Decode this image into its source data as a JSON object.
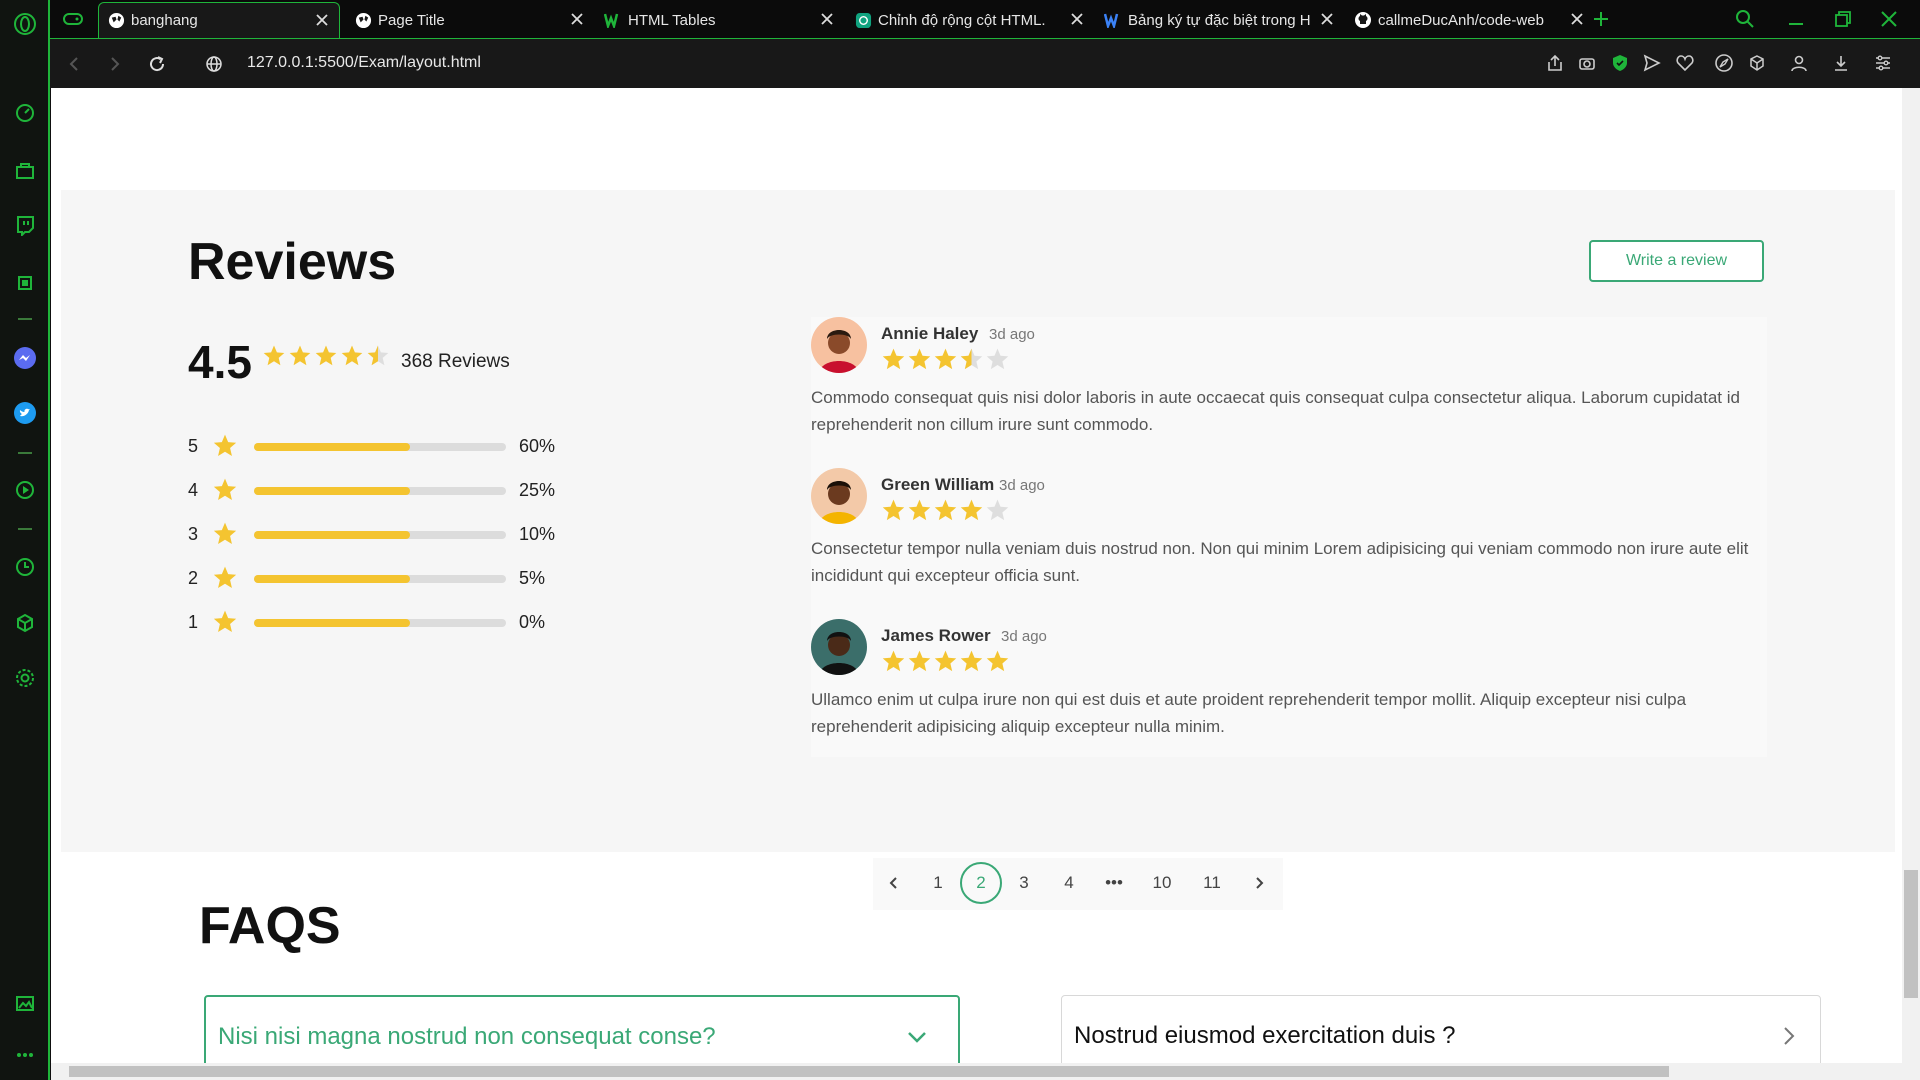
{
  "tabs": [
    {
      "label": "banghang",
      "icon": "globe-icon",
      "active": true
    },
    {
      "label": "Page Title",
      "icon": "globe-icon",
      "active": false
    },
    {
      "label": "HTML Tables",
      "icon": "w3schools-icon",
      "active": false
    },
    {
      "label": "Chỉnh độ rộng cột HTML.",
      "icon": "chatgpt-icon",
      "active": false
    },
    {
      "label": "Bảng ký tự đặc biệt trong H",
      "icon": "word-icon",
      "active": false
    },
    {
      "label": "callmeDucAnh/code-web",
      "icon": "github-icon",
      "active": false
    }
  ],
  "address": {
    "url": "127.0.0.1:5500/Exam/layout.html"
  },
  "colors": {
    "accent": "#3aa876",
    "star": "#f4c430",
    "browser_accent": "#1fb53a"
  },
  "reviews": {
    "title": "Reviews",
    "write_button": "Write a review",
    "average": "4.5",
    "average_stars": 4.5,
    "count_label": "368 Reviews",
    "distribution": [
      {
        "stars": "5",
        "percent": "60%"
      },
      {
        "stars": "4",
        "percent": "25%"
      },
      {
        "stars": "3",
        "percent": "10%"
      },
      {
        "stars": "2",
        "percent": "5%"
      },
      {
        "stars": "1",
        "percent": "0%"
      }
    ],
    "distribution_fill": 0.62,
    "items": [
      {
        "name": "Annie Haley",
        "time": "3d ago",
        "rating": 3.5,
        "text": "Commodo consequat quis nisi dolor laboris in aute occaecat quis consequat culpa consectetur aliqua. Laborum cupidatat id reprehenderit non cillum irure sunt commodo."
      },
      {
        "name": "Green William",
        "time": "3d ago",
        "rating": 4,
        "text": "Consectetur tempor nulla veniam duis nostrud non. Non qui minim Lorem adipisicing qui veniam commodo non irure aute elit incididunt qui excepteur officia sunt."
      },
      {
        "name": "James Rower",
        "time": "3d ago",
        "rating": 5,
        "text": "Ullamco enim ut culpa irure non qui est duis et aute proident reprehenderit tempor mollit. Aliquip excepteur nisi culpa reprehenderit adipisicing aliquip excepteur nulla minim."
      }
    ],
    "pagination": [
      "1",
      "2",
      "3",
      "4",
      "•••",
      "10",
      "11"
    ],
    "current_page": "2"
  },
  "faqs": {
    "title": "FAQS",
    "items": [
      {
        "question": "Nisi nisi magna nostrud non consequat conse?",
        "open": true
      },
      {
        "question": "Nostrud eiusmod exercitation duis ?",
        "open": false
      }
    ]
  }
}
